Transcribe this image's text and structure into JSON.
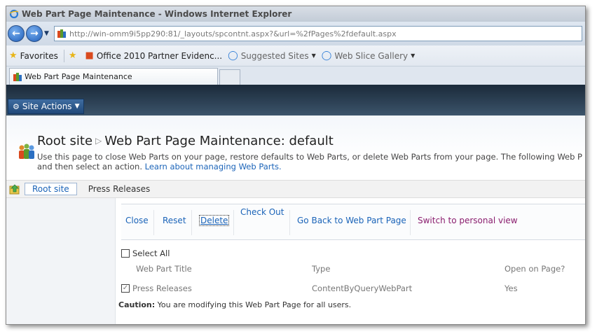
{
  "window": {
    "title": "Web Part Page Maintenance - Windows Internet Explorer"
  },
  "address_bar": {
    "url": "http://win-omm9i5pp290:81/_layouts/spcontnt.aspx?&url=%2fPages%2fdefault.aspx"
  },
  "favorites_bar": {
    "favorites_label": "Favorites",
    "items": [
      {
        "label": "Office 2010 Partner Evidenc...",
        "icon": "sharepoint-icon"
      },
      {
        "label": "Suggested Sites",
        "icon": "ie-icon"
      },
      {
        "label": "Web Slice Gallery",
        "icon": "ie-icon"
      }
    ]
  },
  "tabs": [
    {
      "label": "Web Part Page Maintenance"
    }
  ],
  "ribbon": {
    "site_actions_label": "Site Actions"
  },
  "page": {
    "breadcrumb_root": "Root site",
    "breadcrumb_current": "Web Part Page Maintenance: default",
    "description": "Use this page to close Web Parts on your page, restore defaults to Web Parts, or delete Web Parts from your page. The following Web P",
    "description_line2": "and then select an action.",
    "learn_more_link": "Learn about managing Web Parts."
  },
  "quickbar": {
    "root_site_label": "Root site",
    "current_page_label": "Press Releases"
  },
  "toolbar": {
    "close": "Close",
    "reset": "Reset",
    "delete": "Delete",
    "check_out": "Check Out",
    "go_back": "Go Back to Web Part Page",
    "switch_view": "Switch to personal view"
  },
  "table": {
    "select_all_label": "Select All",
    "headers": [
      "Web Part Title",
      "Type",
      "Open on Page?"
    ],
    "rows": [
      {
        "title": "Press Releases",
        "type": "ContentByQueryWebPart",
        "open": "Yes",
        "checked": true
      }
    ]
  },
  "caution": {
    "label": "Caution:",
    "text": " You are modifying this Web Part Page for all users."
  },
  "colors": {
    "link": "#1a63b8",
    "purple_link": "#8a1d6e",
    "header_band": "#2e4357",
    "site_actions": "#21497a"
  }
}
